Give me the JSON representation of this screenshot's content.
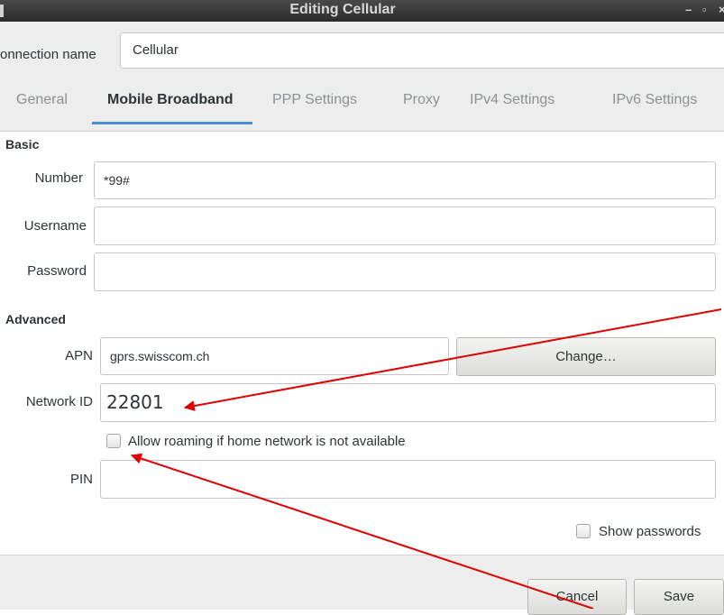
{
  "window": {
    "title": "Editing Cellular",
    "minimize": "–",
    "maximize": "▫",
    "close": "×"
  },
  "connection": {
    "label": "onnection name",
    "value": "Cellular"
  },
  "tabs": [
    "General",
    "Mobile Broadband",
    "PPP Settings",
    "Proxy",
    "IPv4 Settings",
    "IPv6 Settings"
  ],
  "active_tab": "Mobile Broadband",
  "basic": {
    "heading": "Basic",
    "number_label": "Number",
    "number_value": "*99#",
    "username_label": "Username",
    "username_value": "",
    "password_label": "Password",
    "password_value": ""
  },
  "advanced": {
    "heading": "Advanced",
    "apn_label": "APN",
    "apn_value": "gprs.swisscom.ch",
    "change_label": "Change…",
    "network_id_label": "Network ID",
    "network_id_value": "22801",
    "roaming_label": "Allow roaming if home network is not available",
    "roaming_checked": false,
    "pin_label": "PIN",
    "pin_value": ""
  },
  "show_passwords": {
    "label": "Show passwords",
    "checked": false
  },
  "footer": {
    "cancel_label": "Cancel",
    "save_label": "Save"
  },
  "annotation_color": "#e00000"
}
